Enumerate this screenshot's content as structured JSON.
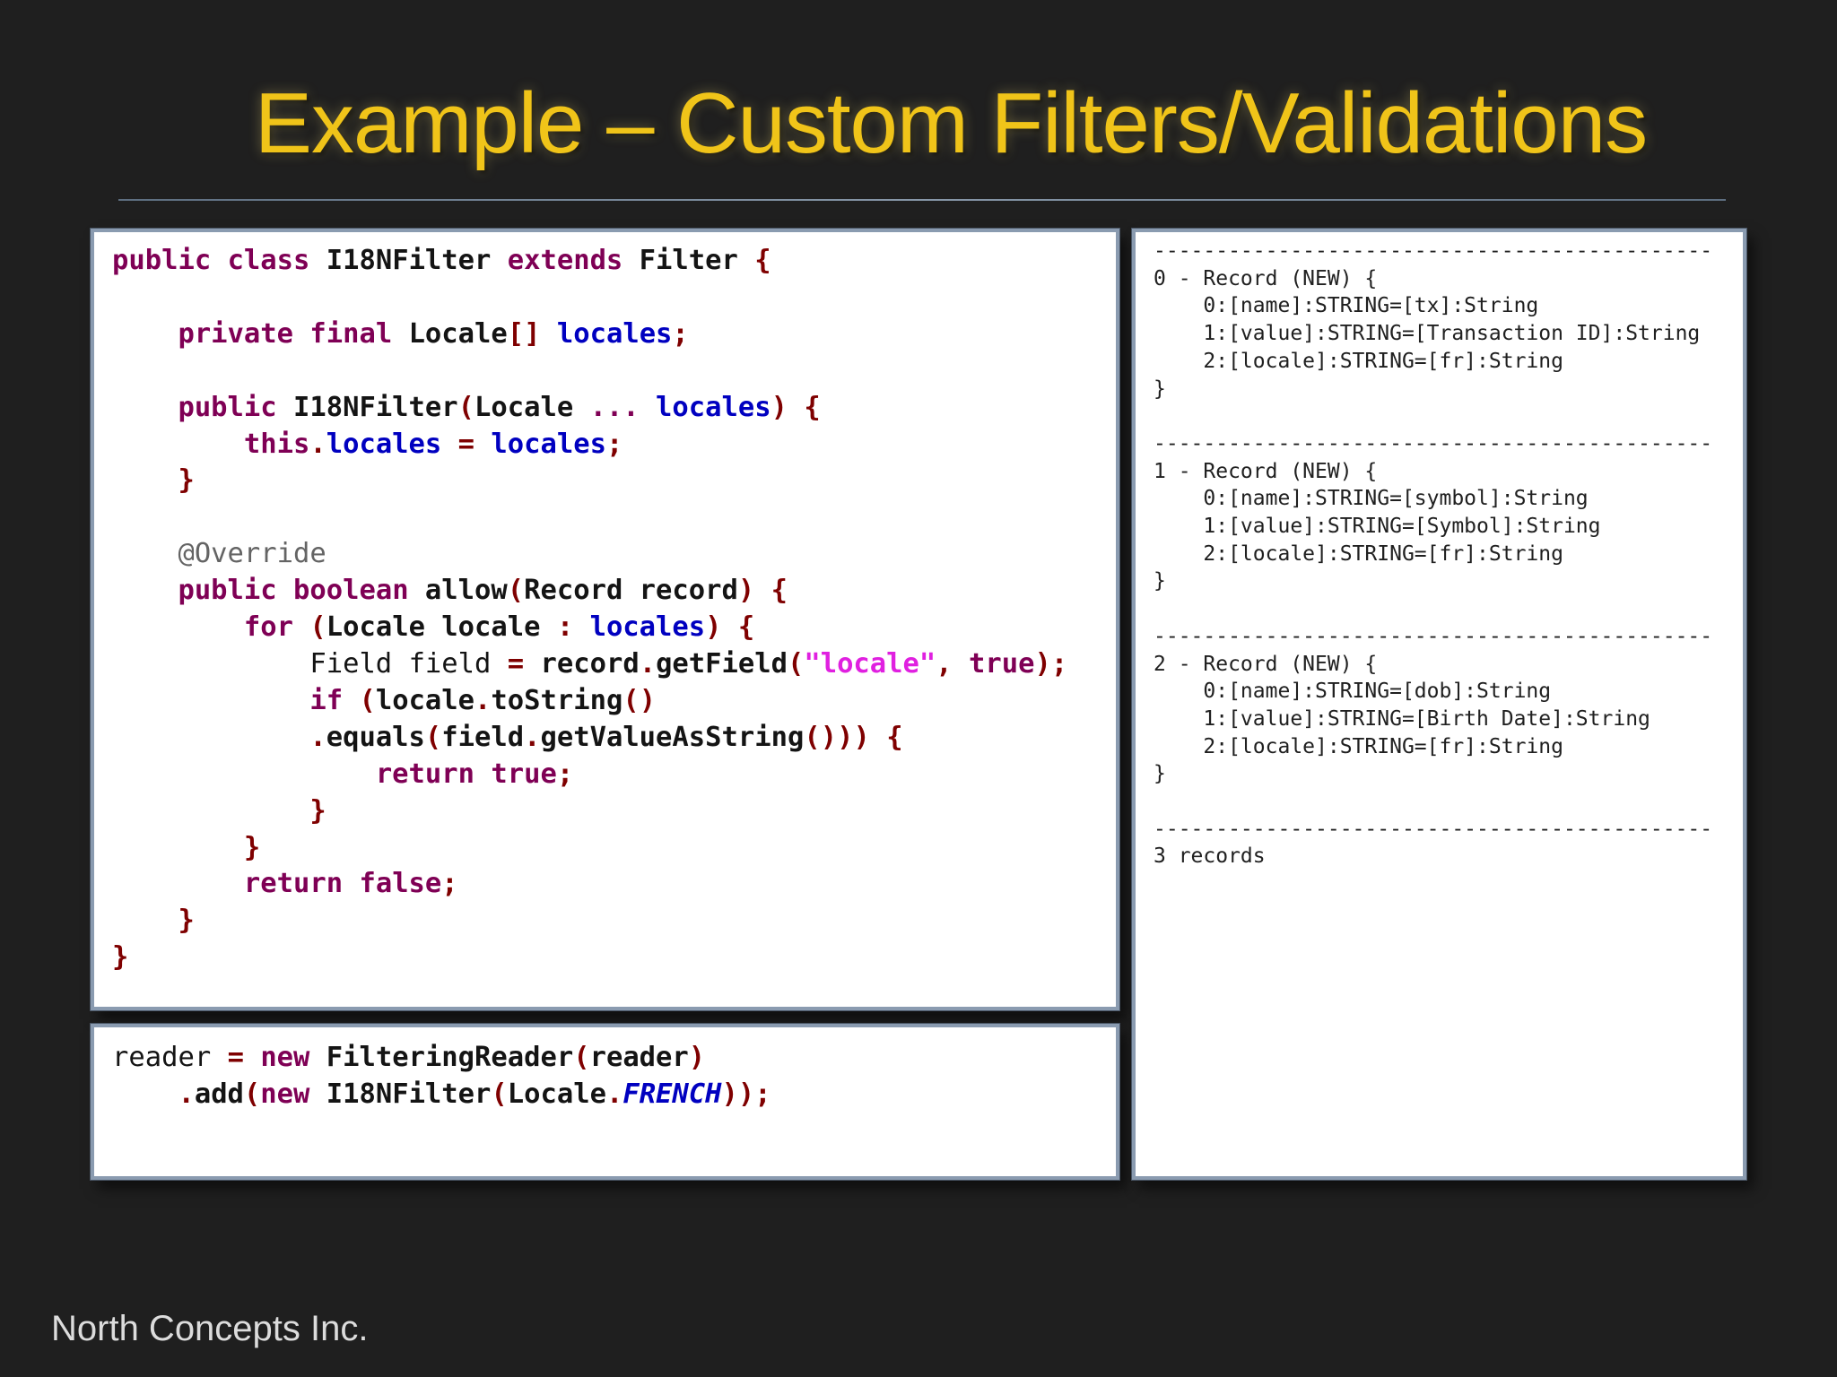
{
  "slide": {
    "title": "Example – Custom Filters/Validations",
    "footer": "North Concepts Inc."
  },
  "code_panel": {
    "lines": [
      "public class I18NFilter extends Filter {",
      "",
      "    private final Locale[] locales;",
      "",
      "    public I18NFilter(Locale ... locales) {",
      "        this.locales = locales;",
      "    }",
      "",
      "    @Override",
      "    public boolean allow(Record record) {",
      "        for (Locale locale : locales) {",
      "            Field field = record.getField(\"locale\", true);",
      "            if (locale.toString()",
      "            .equals(field.getValueAsString())) {",
      "                return true;",
      "            }",
      "        }",
      "        return false;",
      "    }",
      "}"
    ]
  },
  "usage_panel": {
    "lines": [
      "reader = new FilteringReader(reader)",
      "    .add(new I18NFilter(Locale.FRENCH));"
    ]
  },
  "output_panel": {
    "separator": "---------------------------------------------",
    "records": [
      {
        "header": "0 - Record (NEW) {",
        "fields": [
          "0:[name]:STRING=[tx]:String",
          "1:[value]:STRING=[Transaction ID]:String",
          "2:[locale]:STRING=[fr]:String"
        ],
        "close": "}"
      },
      {
        "header": "1 - Record (NEW) {",
        "fields": [
          "0:[name]:STRING=[symbol]:String",
          "1:[value]:STRING=[Symbol]:String",
          "2:[locale]:STRING=[fr]:String"
        ],
        "close": "}"
      },
      {
        "header": "2 - Record (NEW) {",
        "fields": [
          "0:[name]:STRING=[dob]:String",
          "1:[value]:STRING=[Birth Date]:String",
          "2:[locale]:STRING=[fr]:String"
        ],
        "close": "}"
      }
    ],
    "summary": "3 records"
  },
  "colors": {
    "background": "#1f1f1f",
    "title": "#f0c419",
    "keyword": "#7f0055",
    "field": "#0000c0",
    "string": "#e020e0",
    "annotation": "#646464",
    "paren": "#7f0000"
  }
}
